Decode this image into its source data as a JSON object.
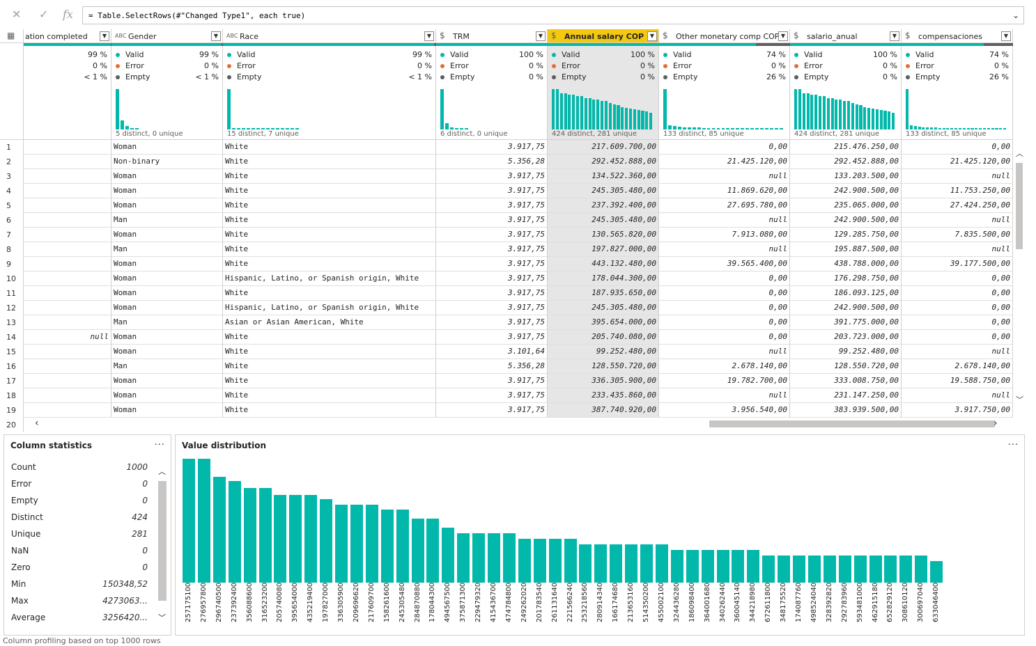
{
  "formula": {
    "text": "= Table.SelectRows(#\"Changed Type1\", each true)",
    "cancel_icon": "close-icon",
    "commit_icon": "check-icon",
    "fx_label": "fx"
  },
  "columns": [
    {
      "key": "c0",
      "type_icon": "",
      "name": "ation completed",
      "selected": false,
      "valid_pct": "99 %",
      "error_pct": "0 %",
      "empty_pct": "< 1 %",
      "distinct_text": "",
      "bars": []
    },
    {
      "key": "c1",
      "type_icon": "ABC",
      "name": "Gender",
      "selected": false,
      "valid_pct": "99 %",
      "error_pct": "0 %",
      "empty_pct": "< 1 %",
      "distinct_text": "5 distinct, 0 unique",
      "bars": [
        1.0,
        0.22,
        0.08,
        0.04,
        0.02
      ]
    },
    {
      "key": "c2",
      "type_icon": "ABC",
      "name": "Race",
      "selected": false,
      "valid_pct": "99 %",
      "error_pct": "0 %",
      "empty_pct": "< 1 %",
      "distinct_text": "15 distinct, 7 unique",
      "bars": [
        1.0,
        0.04,
        0.03,
        0.03,
        0.02,
        0.02,
        0.02,
        0.02,
        0.02,
        0.02,
        0.02,
        0.02,
        0.02,
        0.02,
        0.02
      ]
    },
    {
      "key": "c3",
      "type_icon": "$",
      "name": "TRM",
      "selected": false,
      "valid_pct": "100 %",
      "error_pct": "0 %",
      "empty_pct": "0 %",
      "distinct_text": "6 distinct, 0 unique",
      "bars": [
        1.0,
        0.15,
        0.05,
        0.03,
        0.02,
        0.02
      ]
    },
    {
      "key": "c4",
      "type_icon": "$",
      "name": "Annual salary COP",
      "selected": true,
      "valid_pct": "100 %",
      "error_pct": "0 %",
      "empty_pct": "0 %",
      "distinct_text": "424 distinct, 281 unique",
      "bars": [
        1.0,
        1.0,
        0.9,
        0.9,
        0.86,
        0.86,
        0.82,
        0.82,
        0.78,
        0.78,
        0.74,
        0.74,
        0.7,
        0.7,
        0.66,
        0.62,
        0.6,
        0.56,
        0.54,
        0.52,
        0.5,
        0.48,
        0.46,
        0.44,
        0.42
      ]
    },
    {
      "key": "c5",
      "type_icon": "$",
      "name": "Other monetary comp COP",
      "selected": false,
      "valid_pct": "74 %",
      "error_pct": "0 %",
      "empty_pct": "26 %",
      "distinct_text": "133 distinct, 85 unique",
      "bars": [
        1.0,
        0.1,
        0.08,
        0.07,
        0.06,
        0.05,
        0.05,
        0.05,
        0.04,
        0.04,
        0.04,
        0.04,
        0.04,
        0.04,
        0.04,
        0.04,
        0.04,
        0.04,
        0.04,
        0.04,
        0.04,
        0.04,
        0.04,
        0.04,
        0.04
      ]
    },
    {
      "key": "c6",
      "type_icon": "$",
      "name": "salario_anual",
      "selected": false,
      "valid_pct": "100 %",
      "error_pct": "0 %",
      "empty_pct": "0 %",
      "distinct_text": "424 distinct, 281 unique",
      "bars": [
        1.0,
        1.0,
        0.9,
        0.9,
        0.86,
        0.86,
        0.82,
        0.82,
        0.78,
        0.78,
        0.74,
        0.74,
        0.7,
        0.7,
        0.66,
        0.62,
        0.6,
        0.56,
        0.54,
        0.52,
        0.5,
        0.48,
        0.46,
        0.44,
        0.42
      ]
    },
    {
      "key": "c7",
      "type_icon": "$",
      "name": "compensaciones",
      "selected": false,
      "valid_pct": "74 %",
      "error_pct": "0 %",
      "empty_pct": "26 %",
      "distinct_text": "133 distinct, 85 unique",
      "bars": [
        1.0,
        0.1,
        0.08,
        0.07,
        0.06,
        0.05,
        0.05,
        0.05,
        0.04,
        0.04,
        0.04,
        0.04,
        0.04,
        0.04,
        0.04,
        0.04,
        0.04,
        0.04,
        0.04,
        0.04,
        0.04,
        0.04,
        0.04,
        0.04,
        0.04
      ]
    }
  ],
  "quality_labels": {
    "valid": "Valid",
    "error": "Error",
    "empty": "Empty"
  },
  "rows": [
    {
      "n": "1",
      "c0": "",
      "c1": "Woman",
      "c2": "White",
      "c3": "3.917,75",
      "c4": "217.609.700,00",
      "c5": "0,00",
      "c6": "215.476.250,00",
      "c7": "0,00"
    },
    {
      "n": "2",
      "c0": "",
      "c1": "Non-binary",
      "c2": "White",
      "c3": "5.356,28",
      "c4": "292.452.888,00",
      "c5": "21.425.120,00",
      "c6": "292.452.888,00",
      "c7": "21.425.120,00"
    },
    {
      "n": "3",
      "c0": "",
      "c1": "Woman",
      "c2": "White",
      "c3": "3.917,75",
      "c4": "134.522.360,00",
      "c5": "null",
      "c6": "133.203.500,00",
      "c7": "null"
    },
    {
      "n": "4",
      "c0": "",
      "c1": "Woman",
      "c2": "White",
      "c3": "3.917,75",
      "c4": "245.305.480,00",
      "c5": "11.869.620,00",
      "c6": "242.900.500,00",
      "c7": "11.753.250,00"
    },
    {
      "n": "5",
      "c0": "",
      "c1": "Woman",
      "c2": "White",
      "c3": "3.917,75",
      "c4": "237.392.400,00",
      "c5": "27.695.780,00",
      "c6": "235.065.000,00",
      "c7": "27.424.250,00"
    },
    {
      "n": "6",
      "c0": "",
      "c1": "Man",
      "c2": "White",
      "c3": "3.917,75",
      "c4": "245.305.480,00",
      "c5": "null",
      "c6": "242.900.500,00",
      "c7": "null"
    },
    {
      "n": "7",
      "c0": "",
      "c1": "Woman",
      "c2": "White",
      "c3": "3.917,75",
      "c4": "130.565.820,00",
      "c5": "7.913.080,00",
      "c6": "129.285.750,00",
      "c7": "7.835.500,00"
    },
    {
      "n": "8",
      "c0": "",
      "c1": "Man",
      "c2": "White",
      "c3": "3.917,75",
      "c4": "197.827.000,00",
      "c5": "null",
      "c6": "195.887.500,00",
      "c7": "null"
    },
    {
      "n": "9",
      "c0": "",
      "c1": "Woman",
      "c2": "White",
      "c3": "3.917,75",
      "c4": "443.132.480,00",
      "c5": "39.565.400,00",
      "c6": "438.788.000,00",
      "c7": "39.177.500,00"
    },
    {
      "n": "10",
      "c0": "",
      "c1": "Woman",
      "c2": "Hispanic, Latino, or Spanish origin, White",
      "c3": "3.917,75",
      "c4": "178.044.300,00",
      "c5": "0,00",
      "c6": "176.298.750,00",
      "c7": "0,00"
    },
    {
      "n": "11",
      "c0": "",
      "c1": "Woman",
      "c2": "White",
      "c3": "3.917,75",
      "c4": "187.935.650,00",
      "c5": "0,00",
      "c6": "186.093.125,00",
      "c7": "0,00"
    },
    {
      "n": "12",
      "c0": "",
      "c1": "Woman",
      "c2": "Hispanic, Latino, or Spanish origin, White",
      "c3": "3.917,75",
      "c4": "245.305.480,00",
      "c5": "0,00",
      "c6": "242.900.500,00",
      "c7": "0,00"
    },
    {
      "n": "13",
      "c0": "",
      "c1": "Man",
      "c2": "Asian or Asian American, White",
      "c3": "3.917,75",
      "c4": "395.654.000,00",
      "c5": "0,00",
      "c6": "391.775.000,00",
      "c7": "0,00"
    },
    {
      "n": "14",
      "c0": "null",
      "c1": "Woman",
      "c2": "White",
      "c3": "3.917,75",
      "c4": "205.740.080,00",
      "c5": "0,00",
      "c6": "203.723.000,00",
      "c7": "0,00"
    },
    {
      "n": "15",
      "c0": "",
      "c1": "Woman",
      "c2": "White",
      "c3": "3.101,64",
      "c4": "99.252.480,00",
      "c5": "null",
      "c6": "99.252.480,00",
      "c7": "null"
    },
    {
      "n": "16",
      "c0": "",
      "c1": "Man",
      "c2": "White",
      "c3": "5.356,28",
      "c4": "128.550.720,00",
      "c5": "2.678.140,00",
      "c6": "128.550.720,00",
      "c7": "2.678.140,00"
    },
    {
      "n": "17",
      "c0": "",
      "c1": "Woman",
      "c2": "White",
      "c3": "3.917,75",
      "c4": "336.305.900,00",
      "c5": "19.782.700,00",
      "c6": "333.008.750,00",
      "c7": "19.588.750,00"
    },
    {
      "n": "18",
      "c0": "",
      "c1": "Woman",
      "c2": "White",
      "c3": "3.917,75",
      "c4": "233.435.860,00",
      "c5": "null",
      "c6": "231.147.250,00",
      "c7": "null"
    },
    {
      "n": "19",
      "c0": "",
      "c1": "Woman",
      "c2": "White",
      "c3": "3.917,75",
      "c4": "387.740.920,00",
      "c5": "3.956.540,00",
      "c6": "383.939.500,00",
      "c7": "3.917.750,00"
    }
  ],
  "last_row_number": "20",
  "column_statistics": {
    "title": "Column statistics",
    "more": "...",
    "items": [
      {
        "label": "Count",
        "value": "1000"
      },
      {
        "label": "Error",
        "value": "0"
      },
      {
        "label": "Empty",
        "value": "0"
      },
      {
        "label": "Distinct",
        "value": "424"
      },
      {
        "label": "Unique",
        "value": "281"
      },
      {
        "label": "NaN",
        "value": "0"
      },
      {
        "label": "Zero",
        "value": "0"
      },
      {
        "label": "Min",
        "value": "150348,52"
      },
      {
        "label": "Max",
        "value": "4273063..."
      },
      {
        "label": "Average",
        "value": "3256420..."
      }
    ]
  },
  "value_distribution": {
    "title": "Value distribution",
    "more": "..."
  },
  "chart_data": {
    "type": "bar",
    "title": "Value distribution",
    "categories": [
      "257175100",
      "276957800",
      "296740500",
      "237392400",
      "356088600",
      "316523200",
      "205740080",
      "395654000",
      "435219400",
      "197827000",
      "336305900",
      "209696620",
      "217609700",
      "158261600",
      "245305480",
      "284870880",
      "178044300",
      "494567500",
      "375871300",
      "229479320",
      "415436700",
      "474784800",
      "249262020",
      "201783540",
      "261131640",
      "221566240",
      "253218560",
      "280914340",
      "166174680",
      "213653160",
      "514350200",
      "455002100",
      "324436280",
      "186098400",
      "364001680",
      "340262440",
      "360045140",
      "344218980",
      "672611800",
      "348175520",
      "174087760",
      "498524040",
      "328392820",
      "292783960",
      "593481000",
      "462915180",
      "652829120",
      "308610120",
      "300697040",
      "633046400"
    ],
    "values": [
      11,
      11,
      9.4,
      9,
      8.4,
      8.4,
      7.8,
      7.8,
      7.8,
      7.4,
      6.9,
      6.9,
      6.9,
      6.5,
      6.5,
      5.7,
      5.7,
      4.9,
      4.4,
      4.4,
      4.4,
      4.4,
      3.9,
      3.9,
      3.9,
      3.9,
      3.4,
      3.4,
      3.4,
      3.4,
      3.4,
      3.4,
      2.9,
      2.9,
      2.9,
      2.9,
      2.9,
      2.9,
      2.4,
      2.4,
      2.4,
      2.4,
      2.4,
      2.4,
      2.4,
      2.4,
      2.4,
      2.4,
      2.4,
      1.9
    ],
    "xlabel": "",
    "ylabel": "",
    "legend": "none",
    "grid": false
  },
  "footer": {
    "text": "Column profiling based on top 1000 rows"
  },
  "colors": {
    "accent": "#01b8aa",
    "selected_header": "#f2c811",
    "valid": "#01b8aa",
    "error": "#e66c37",
    "empty": "#605e5c"
  }
}
